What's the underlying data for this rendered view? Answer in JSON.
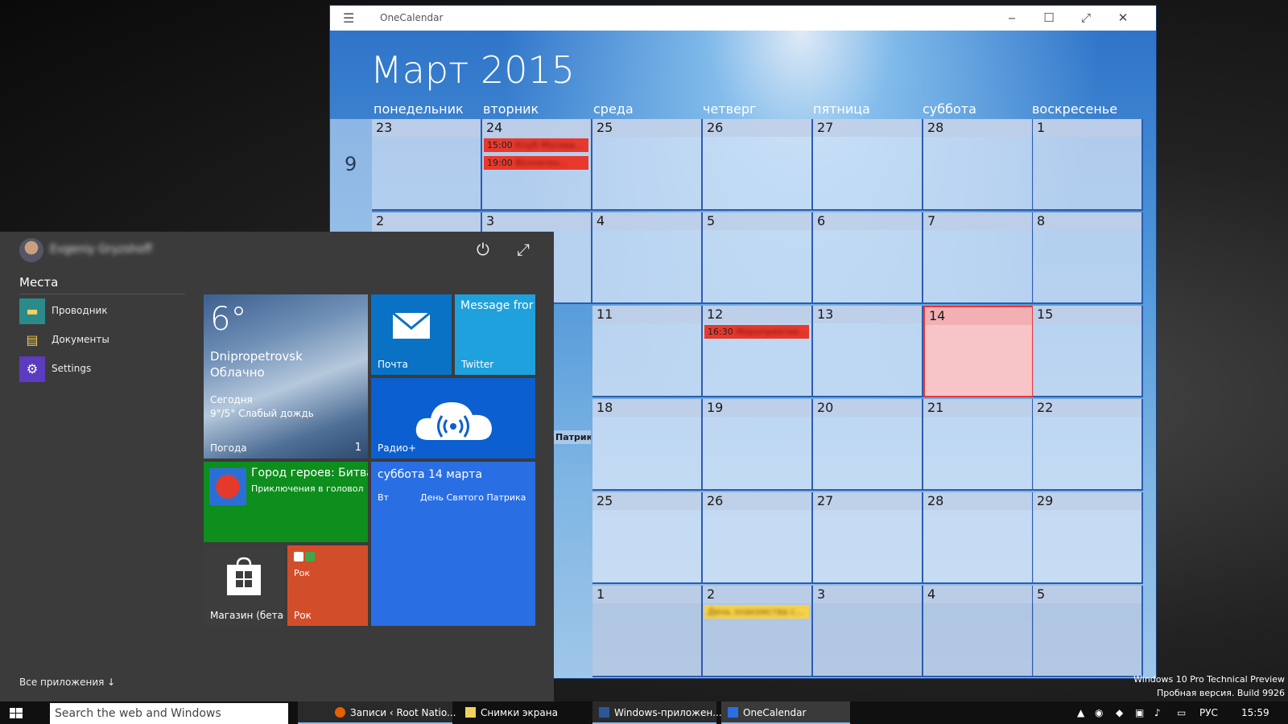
{
  "calendar_window": {
    "title": "OneCalendar",
    "month_title": "Март 2015",
    "day_headers": [
      "понедельник",
      "вторник",
      "среда",
      "четверг",
      "пятница",
      "суббота",
      "воскресенье"
    ],
    "week_number": "9",
    "weeks": [
      {
        "days": [
          "23",
          "24",
          "25",
          "26",
          "27",
          "28",
          "1"
        ]
      },
      {
        "days": [
          "2",
          "3",
          "4",
          "5",
          "6",
          "7",
          "8"
        ]
      },
      {
        "days": [
          "",
          "",
          "11",
          "12",
          "13",
          "14",
          "15"
        ]
      },
      {
        "days": [
          "",
          "",
          "18",
          "19",
          "20",
          "21",
          "22"
        ]
      },
      {
        "days": [
          "",
          "",
          "25",
          "26",
          "27",
          "28",
          "29"
        ]
      },
      {
        "days": [
          "",
          "",
          "1",
          "2",
          "3",
          "4",
          "5"
        ]
      }
    ],
    "events": {
      "tue24_1_time": "15:00",
      "tue24_1_title": "Клуб Москва...",
      "tue24_2_time": "19:00",
      "tue24_2_title": "Вознесен...",
      "thu12_time": "16:30",
      "thu12_title": "Мероприятие...",
      "patrick": "Патрика",
      "thu2_title": "День знакомства с..."
    },
    "today": "14"
  },
  "start_menu": {
    "user_name": "Evgeniy Gryzshoff",
    "places_title": "Места",
    "places": [
      {
        "label": "Проводник"
      },
      {
        "label": "Документы"
      },
      {
        "label": "Settings"
      }
    ],
    "all_apps": "Все приложения ↓",
    "tiles": {
      "weather_temp": "6°",
      "weather_city": "Dnipropetrovsk",
      "weather_cond": "Облачно",
      "weather_today": "Сегодня",
      "weather_forecast": "9°/5° Слабый дождь",
      "weather_label": "Погода",
      "weather_badge": "1",
      "mail_label": "Почта",
      "twitter_text": "Message fror",
      "twitter_label": "Twitter",
      "radio_label": "Радио+",
      "game_title": "Город героев: Битва",
      "game_sub": "Приключения в головол",
      "calendar_date": "суббота 14 марта",
      "calendar_day": "Вт",
      "calendar_event": "День Святого Патрика",
      "store_label": "Магазин (бета-",
      "rock_top": "Рок",
      "rock_label": "Рок"
    }
  },
  "taskbar": {
    "search_placeholder": "Search the web and Windows",
    "items": [
      {
        "label": "Записи ‹ Root Natio..."
      },
      {
        "label": "Снимки экрана"
      },
      {
        "label": "Windows-приложен..."
      },
      {
        "label": "OneCalendar"
      }
    ],
    "lang": "РУС",
    "time": "15:59"
  },
  "watermark": {
    "line1": "Windows 10 Pro Technical Preview",
    "line2": "Пробная версия. Build 9926"
  }
}
